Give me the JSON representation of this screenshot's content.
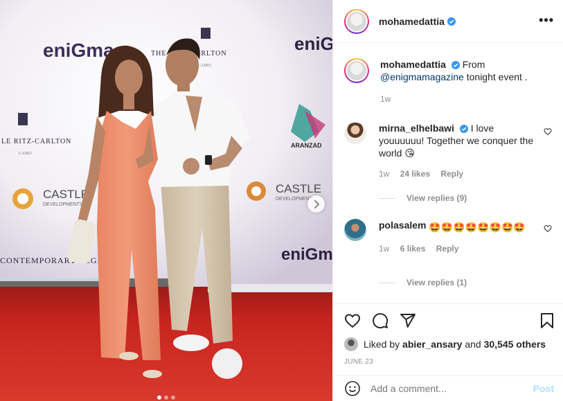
{
  "post": {
    "author": "mohamedattia",
    "header_more": "•••",
    "caption": {
      "username": "mohamedattia",
      "text_before": "From",
      "mention": "@enigmamagazine",
      "text_after": "tonight event .",
      "age": "1w"
    },
    "comments": [
      {
        "username": "mirna_elhelbawi",
        "text": "I love youuuuuu! Together we conquer the world 😘",
        "age": "1w",
        "likes": "24 likes",
        "reply": "Reply",
        "view_replies": "View replies (9)"
      },
      {
        "username": "polasalem",
        "text": "🤩🤩🤩🤩🤩🤩🤩🤩",
        "age": "1w",
        "likes": "6 likes",
        "reply": "Reply",
        "view_replies": "View replies (1)"
      }
    ],
    "liked_by_prefix": "Liked by",
    "liked_by_user": "abier_ansary",
    "liked_by_and": "and",
    "liked_by_others": "30,545 others",
    "date": "JUNE 23",
    "add_comment_placeholder": "Add a comment...",
    "post_button": "Post"
  },
  "photo": {
    "backdrop_texts": {
      "enigma": "eniGma",
      "ritz": "THE RITZ-CARLTON",
      "ritz2": "LE RITZ-CARLTON",
      "cairo": "CAIRO",
      "castle": "CASTLE",
      "developments": "DEVELOPMENTS",
      "aranzad": "ARANZAD",
      "legacy": "CONTEMPORARY LEGACY"
    },
    "carousel_total": 3,
    "carousel_active": 1
  },
  "colors": {
    "verified": "#3897f0",
    "link": "#00376b",
    "muted": "#8e8e8e",
    "post_disabled": "#b2dffc",
    "carpet": "#c8241f"
  }
}
